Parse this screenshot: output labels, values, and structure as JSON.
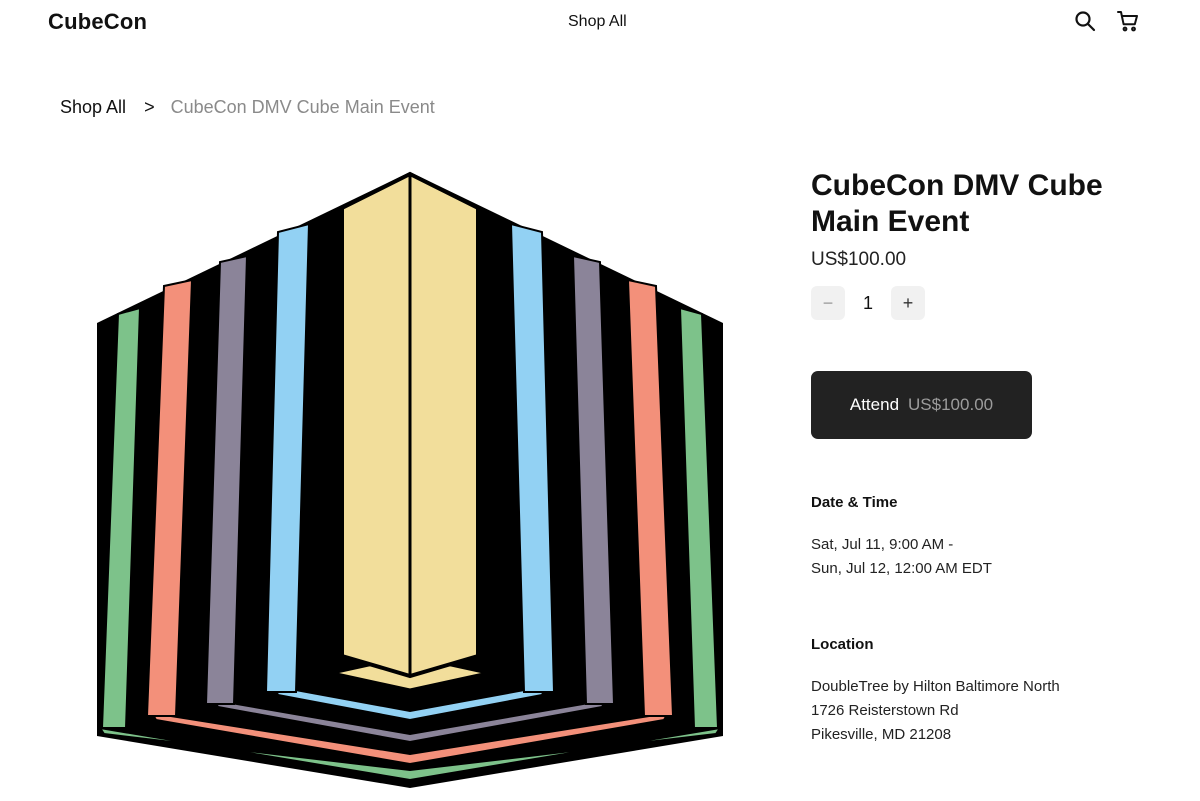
{
  "header": {
    "logo": "CubeCon",
    "nav_link": "Shop All",
    "search_icon": "search-icon",
    "cart_icon": "cart-icon"
  },
  "breadcrumb": {
    "parent": "Shop All",
    "separator": ">",
    "current": "CubeCon DMV Cube Main Event"
  },
  "product": {
    "title": "CubeCon DMV Cube Main Event",
    "price": "US$100.00",
    "quantity": "1",
    "decrement_symbol": "−",
    "increment_symbol": "+",
    "attend_label": "Attend",
    "attend_price": "US$100.00",
    "date_time_heading": "Date & Time",
    "date_time_lines": [
      "Sat, Jul 11, 9:00 AM -",
      "Sun, Jul 12, 12:00 AM EDT"
    ],
    "location_heading": "Location",
    "location_lines": [
      "DoubleTree by Hilton Baltimore North",
      "1726 Reisterstown Rd",
      "Pikesville, MD 21208"
    ]
  },
  "colors": {
    "button_bg": "#222222",
    "cube_yellow": "#f2de9b",
    "cube_blue": "#92d1f3",
    "cube_purple": "#8b8499",
    "cube_salmon": "#f3907a",
    "cube_green": "#7dc28a"
  }
}
